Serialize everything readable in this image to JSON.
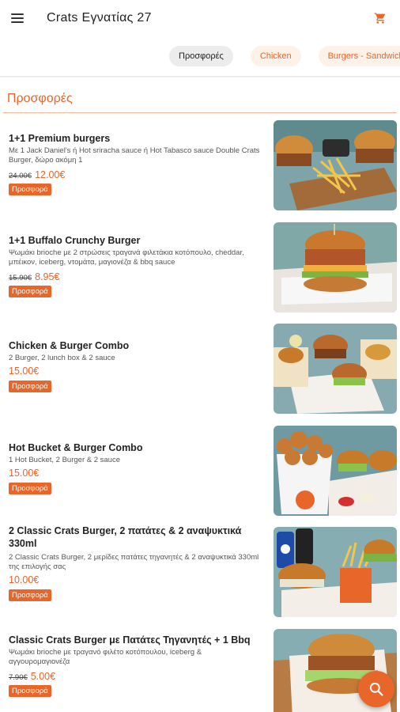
{
  "header": {
    "title": "Crats Εγνατίας 27"
  },
  "categories": [
    {
      "label": "Προσφορές",
      "active": true
    },
    {
      "label": "Chicken",
      "active": false
    },
    {
      "label": "Burgers - Sandwiches",
      "active": false
    }
  ],
  "section": {
    "title": "Προσφορές"
  },
  "items": [
    {
      "name": "1+1 Premium burgers",
      "description": "Με 1 Jack Daniel's ή Hot sriracha sauce ή Hot Tabasco sauce Double Crats Burger, δώρο ακόμη 1",
      "old_price": "24.00€",
      "price": "12.00€",
      "badge": "Προσφορά"
    },
    {
      "name": "1+1 Buffalo Crunchy Burger",
      "description": "Ψωμάκι brioche με 2 στρώσεις τραγανά φιλετάκια κοτόπουλο, cheddar, μπέικον, iceberg, ντομάτα, μαγιονέζα & bbq sauce",
      "old_price": "15.90€",
      "price": "8.95€",
      "badge": "Προσφορά"
    },
    {
      "name": "Chicken & Burger Combo",
      "description": "2 Burger, 2 lunch box & 2 sauce",
      "old_price": "",
      "price": "15.00€",
      "badge": "Προσφορά"
    },
    {
      "name": "Hot Bucket & Burger Combo",
      "description": "1 Hot Bucket, 2 Burger & 2 sauce",
      "old_price": "",
      "price": "15.00€",
      "badge": "Προσφορά"
    },
    {
      "name": "2 Classic Crats Burger, 2 πατάτες & 2 αναψυκτικά 330ml",
      "description": "2 Classic Crats Burger, 2 μερίδες πατάτες τηγανητές & 2 αναψυκτικά 330ml της επιλογής σας",
      "old_price": "",
      "price": "10.00€",
      "badge": "Προσφορά"
    },
    {
      "name": "Classic Crats Burger με Πατάτες Τηγανητές + 1 Bbq",
      "description": "Ψωμάκι brioche με τραγανό φιλέτο κοτόπουλου, iceberg & αγγουρομαγιονέζα",
      "old_price": "7.90€",
      "price": "5.00€",
      "badge": "Προσφορά"
    }
  ],
  "icons": {
    "menu": "menu-icon",
    "cart": "cart-icon",
    "search": "search-icon"
  },
  "colors": {
    "accent": "#e8662a",
    "chip_inactive_bg": "#fdf1e8",
    "chip_active_bg": "#ececec"
  }
}
